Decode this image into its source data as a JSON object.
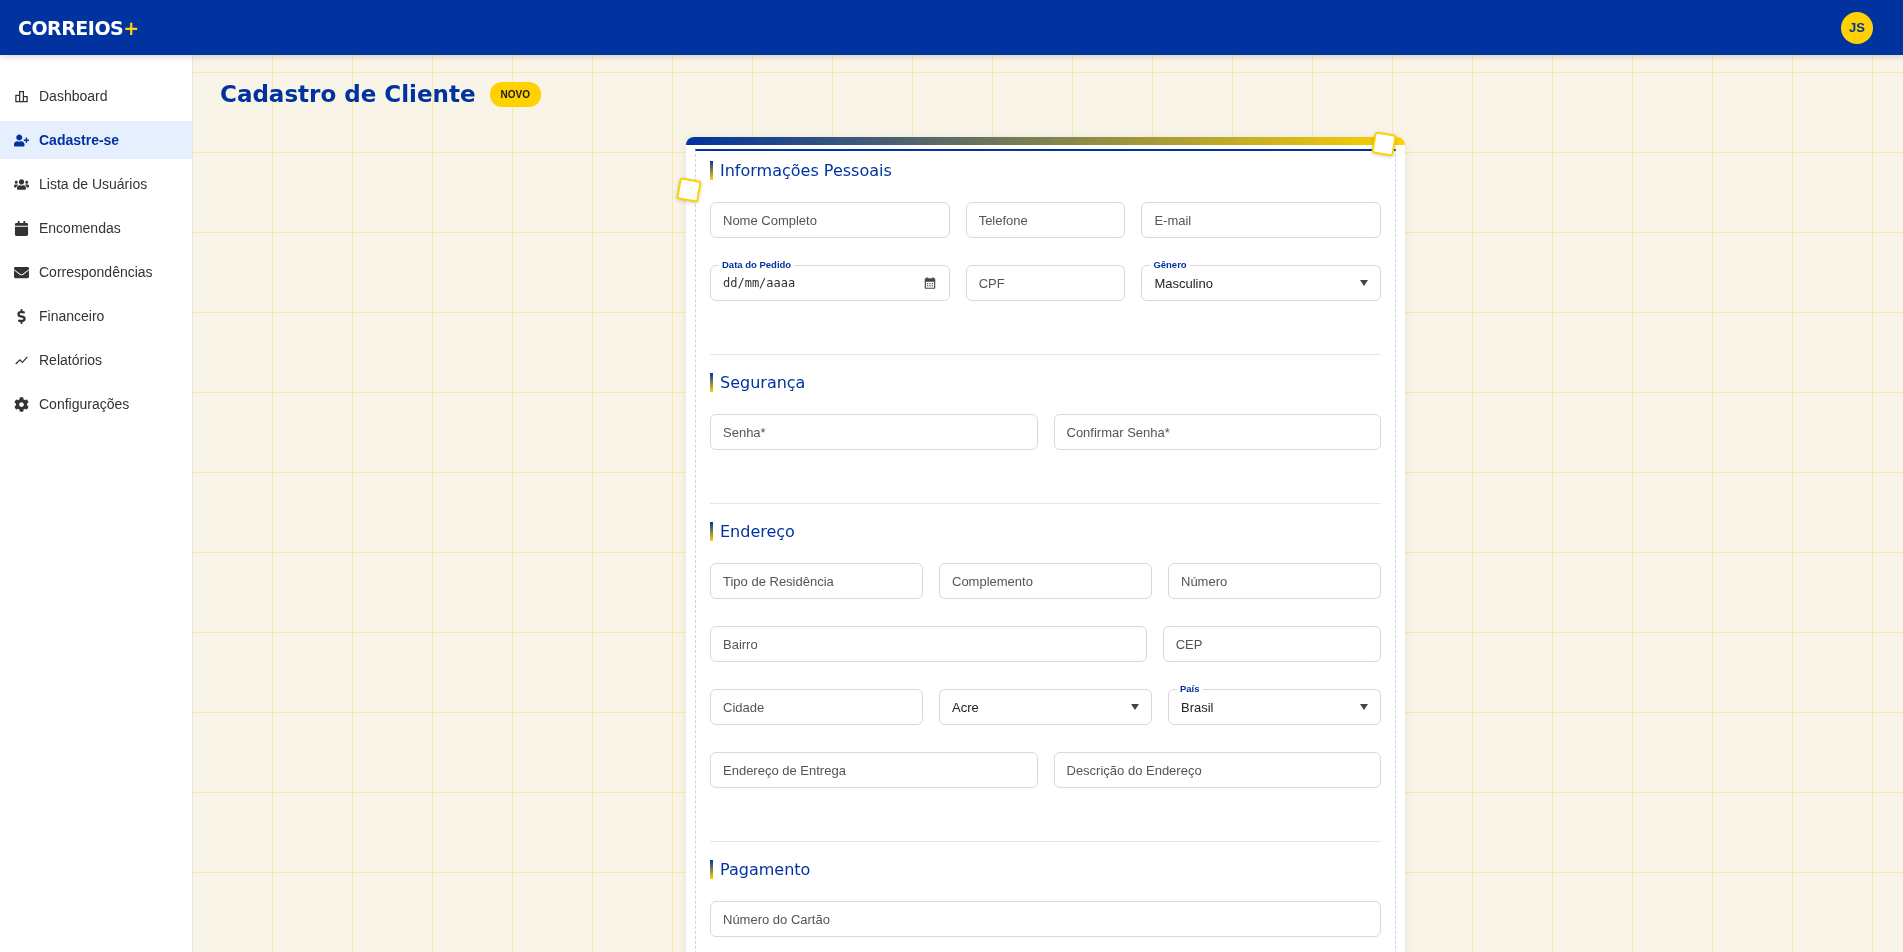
{
  "header": {
    "logo": "CORREIOS",
    "logo_mark": "+",
    "avatar": "JS"
  },
  "sidebar": {
    "items": [
      {
        "label": "Dashboard",
        "selected": false
      },
      {
        "label": "Cadastre-se",
        "selected": true
      },
      {
        "label": "Lista de Usuários",
        "selected": false
      },
      {
        "label": "Encomendas",
        "selected": false
      },
      {
        "label": "Correspondências",
        "selected": false
      },
      {
        "label": "Financeiro",
        "selected": false
      },
      {
        "label": "Relatórios",
        "selected": false
      },
      {
        "label": "Configurações",
        "selected": false
      }
    ]
  },
  "page": {
    "title": "Cadastro de Cliente",
    "badge": "NOVO"
  },
  "form": {
    "sections": [
      {
        "title": "Informações Pessoais",
        "rows": [
          [
            {
              "kind": "text",
              "placeholder": "Nome Completo"
            },
            {
              "kind": "text",
              "placeholder": "Telefone"
            },
            {
              "kind": "text",
              "placeholder": "E-mail"
            }
          ],
          [
            {
              "kind": "date",
              "label": "Data do Pedido",
              "placeholder": "dd/mm/aaaa"
            },
            {
              "kind": "text",
              "placeholder": "CPF"
            },
            {
              "kind": "select",
              "label": "Gênero",
              "value": "Masculino"
            }
          ]
        ]
      },
      {
        "title": "Segurança",
        "rows": [
          [
            {
              "kind": "text",
              "placeholder": "Senha*"
            },
            {
              "kind": "text",
              "placeholder": "Confirmar Senha*"
            }
          ]
        ]
      },
      {
        "title": "Endereço",
        "rows": [
          [
            {
              "kind": "text",
              "placeholder": "Tipo de Residência"
            },
            {
              "kind": "text",
              "placeholder": "Complemento"
            },
            {
              "kind": "text",
              "placeholder": "Número"
            }
          ],
          [
            {
              "kind": "text",
              "placeholder": "Bairro"
            },
            {
              "kind": "text",
              "placeholder": "CEP"
            }
          ],
          [
            {
              "kind": "text",
              "placeholder": "Cidade"
            },
            {
              "kind": "select",
              "value": "Acre"
            },
            {
              "kind": "select",
              "label": "País",
              "value": "Brasil"
            }
          ],
          [
            {
              "kind": "text",
              "placeholder": "Endereço de Entrega"
            },
            {
              "kind": "text",
              "placeholder": "Descrição do Endereço"
            }
          ]
        ]
      },
      {
        "title": "Pagamento",
        "rows": [
          [
            {
              "kind": "text",
              "placeholder": "Número do Cartão"
            }
          ]
        ]
      }
    ]
  }
}
